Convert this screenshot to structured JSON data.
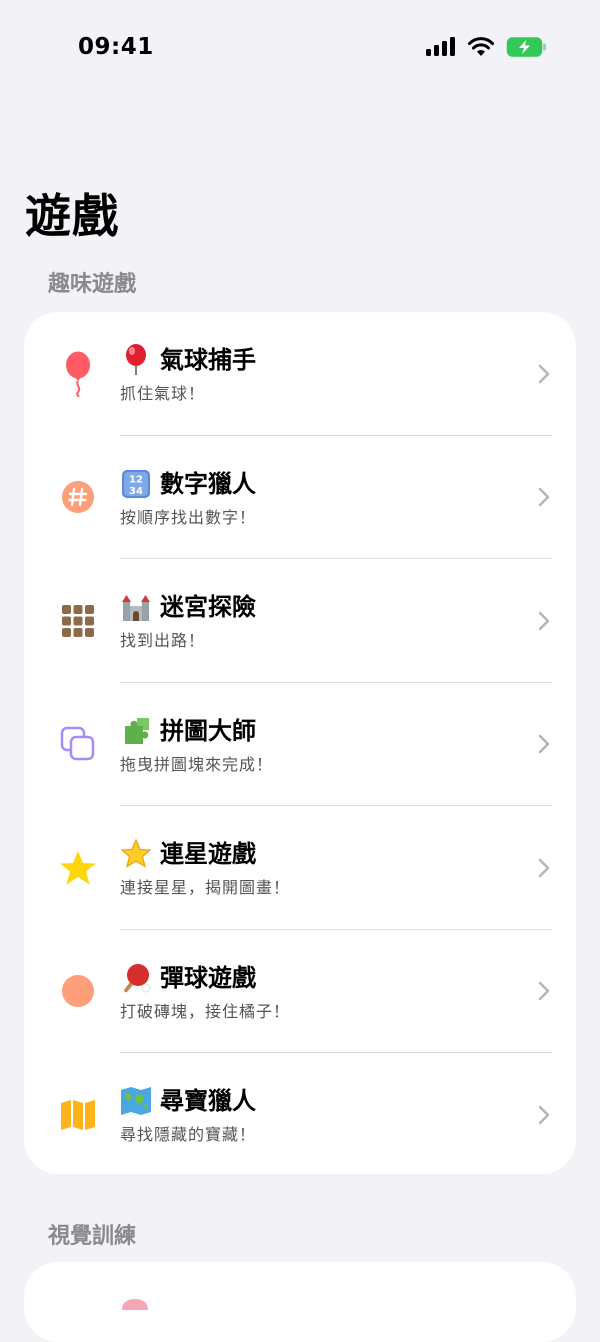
{
  "status": {
    "time": "09:41"
  },
  "page_title": "遊戲",
  "sections": [
    {
      "header": "趣味遊戲",
      "rows": [
        {
          "icon": "balloon-icon",
          "emoji": "balloon-emoji",
          "title": "氣球捕手",
          "subtitle": "抓住氣球！"
        },
        {
          "icon": "number-badge-icon",
          "emoji": "keycap-1234-emoji",
          "title": "數字獵人",
          "subtitle": "按順序找出數字！"
        },
        {
          "icon": "grid-icon",
          "emoji": "castle-emoji",
          "title": "迷宮探險",
          "subtitle": "找到出路！"
        },
        {
          "icon": "squares-icon",
          "emoji": "puzzle-emoji",
          "title": "拼圖大師",
          "subtitle": "拖曳拼圖塊來完成！"
        },
        {
          "icon": "star-icon",
          "emoji": "star-emoji",
          "title": "連星遊戲",
          "subtitle": "連接星星，揭開圖畫！"
        },
        {
          "icon": "circle-icon",
          "emoji": "ping-pong-emoji",
          "title": "彈球遊戲",
          "subtitle": "打破磚塊，接住橘子！"
        },
        {
          "icon": "map-icon",
          "emoji": "world-map-emoji",
          "title": "尋寶獵人",
          "subtitle": "尋找隱藏的寶藏！"
        }
      ]
    },
    {
      "header": "視覺訓練"
    }
  ]
}
